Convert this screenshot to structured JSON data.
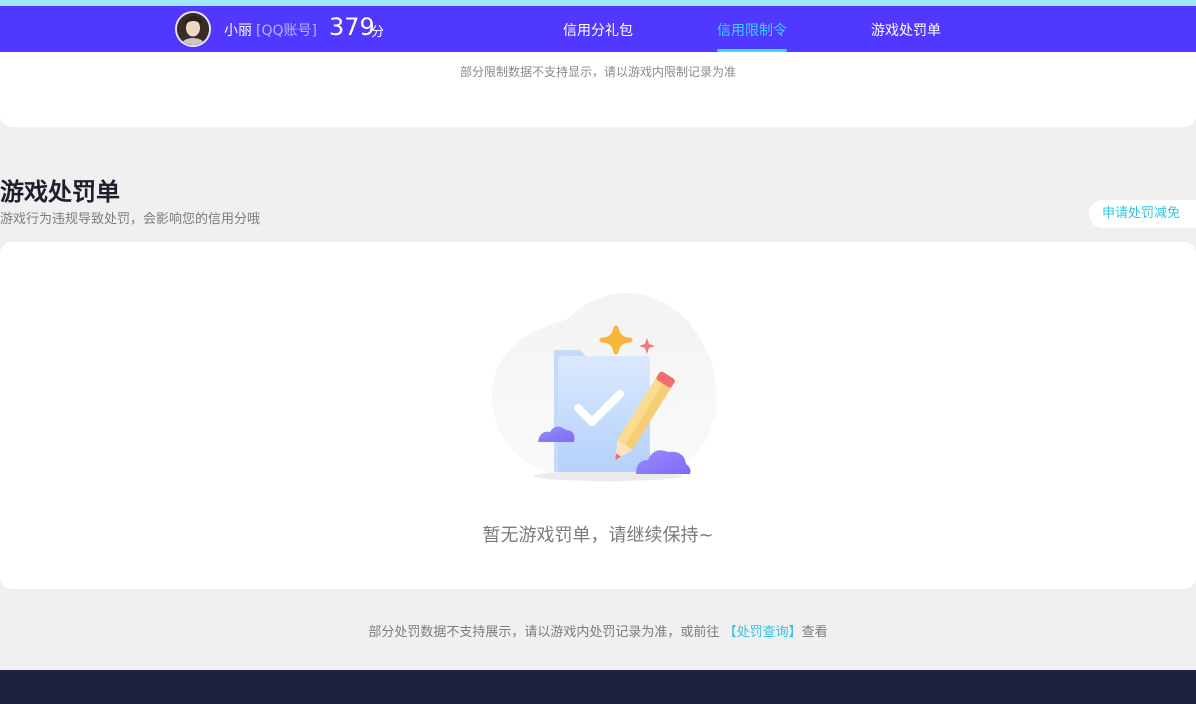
{
  "header": {
    "user_name": "小丽",
    "account_type": "[QQ账号]",
    "score": "379",
    "score_unit": "分",
    "tabs": [
      {
        "label": "信用分礼包",
        "active": false
      },
      {
        "label": "信用限制令",
        "active": true
      },
      {
        "label": "游戏处罚单",
        "active": false
      }
    ],
    "accent_color": "#5038ff",
    "active_tab_color": "#3fd3ff"
  },
  "limit_section": {
    "note": "部分限制数据不支持显示，请以游戏内限制记录为准"
  },
  "penalty_section": {
    "title": "游戏处罚单",
    "description": "游戏行为违规导致处罚，会影响您的信用分哦",
    "reduce_button": "申请处罚减免",
    "empty_icon": "empty-folder-pencil-illustration",
    "empty_text": "暂无游戏罚单，请继续保持~",
    "bottom_note_prefix": "部分处罚数据不支持展示，请以游戏内处罚记录为准，或前往",
    "bottom_link": "【处罚查询】",
    "bottom_note_suffix": "查看"
  }
}
